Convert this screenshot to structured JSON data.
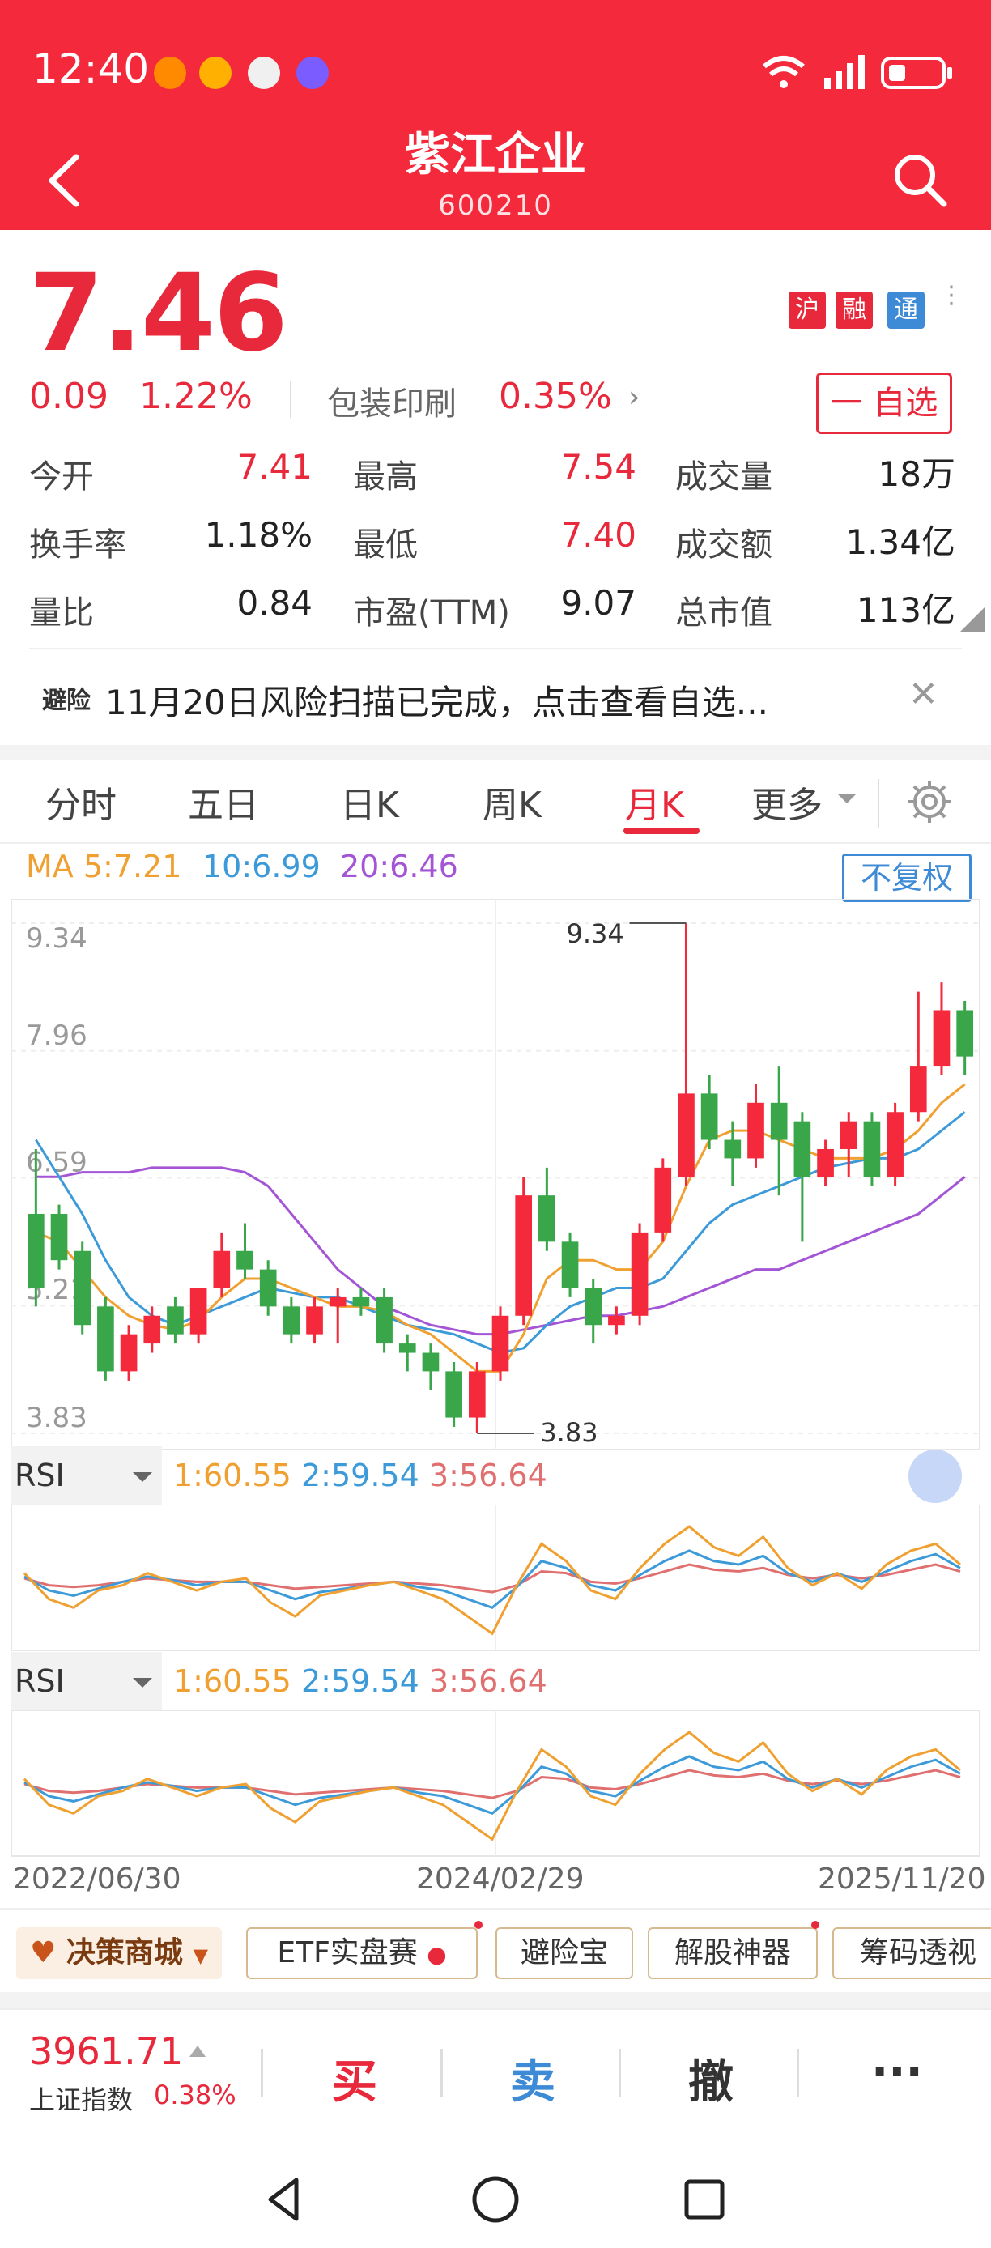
{
  "status": {
    "time": "12:40"
  },
  "header": {
    "title": "紫江企业",
    "code": "600210"
  },
  "quote": {
    "price": "7.46",
    "change": "0.09",
    "change_pct": "1.22%",
    "sector": "包装印刷",
    "sector_pct": "0.35%",
    "badges": [
      "沪",
      "融",
      "通"
    ],
    "watch_label": "一 自选"
  },
  "stats": [
    {
      "label": "今开",
      "value": "7.41",
      "color": "red"
    },
    {
      "label": "最高",
      "value": "7.54",
      "color": "red"
    },
    {
      "label": "成交量",
      "value": "18万",
      "color": "black"
    },
    {
      "label": "换手率",
      "value": "1.18%",
      "color": "black"
    },
    {
      "label": "最低",
      "value": "7.40",
      "color": "red"
    },
    {
      "label": "成交额",
      "value": "1.34亿",
      "color": "black"
    },
    {
      "label": "量比",
      "value": "0.84",
      "color": "black"
    },
    {
      "label": "市盈(TTM)",
      "value": "9.07",
      "color": "black"
    },
    {
      "label": "总市值",
      "value": "113亿",
      "color": "black"
    }
  ],
  "notice": {
    "tag": "避险",
    "text": "11月20日风险扫描已完成，点击查看自选..."
  },
  "tabs": [
    "分时",
    "五日",
    "日K",
    "周K",
    "月K",
    "更多"
  ],
  "active_tab": "月K",
  "ma": {
    "ma5": "MA 5:7.21",
    "ma10": "10:6.99",
    "ma20": "20:6.46",
    "adjust": "不复权"
  },
  "chart_data": {
    "type": "candlestick",
    "y_ticks": [
      "9.34",
      "7.96",
      "6.59",
      "5.21",
      "3.83"
    ],
    "ylim": [
      3.83,
      9.34
    ],
    "max_label": "9.34",
    "min_label": "3.83",
    "x_labels": [
      "2022/06/30",
      "2024/02/29",
      "2025/11/20"
    ],
    "colors": {
      "up": "#f4293b",
      "down": "#38a649",
      "ma5": "#f0a030",
      "ma10": "#3d9ad9",
      "ma20": "#a455d6"
    },
    "candles": [
      [
        6.2,
        5.4,
        6.9,
        5.2
      ],
      [
        6.2,
        5.7,
        6.3,
        5.6
      ],
      [
        5.8,
        5.0,
        5.9,
        4.9
      ],
      [
        5.2,
        4.5,
        5.3,
        4.4
      ],
      [
        4.5,
        4.9,
        5.0,
        4.4
      ],
      [
        4.8,
        5.1,
        5.2,
        4.7
      ],
      [
        5.2,
        4.9,
        5.3,
        4.8
      ],
      [
        4.9,
        5.4,
        5.4,
        4.8
      ],
      [
        5.4,
        5.8,
        6.0,
        5.3
      ],
      [
        5.8,
        5.6,
        6.1,
        5.5
      ],
      [
        5.6,
        5.2,
        5.7,
        5.1
      ],
      [
        5.2,
        4.9,
        5.3,
        4.8
      ],
      [
        4.9,
        5.2,
        5.3,
        4.8
      ],
      [
        5.2,
        5.3,
        5.4,
        4.8
      ],
      [
        5.3,
        5.2,
        5.4,
        5.1
      ],
      [
        5.3,
        4.8,
        5.4,
        4.7
      ],
      [
        4.8,
        4.7,
        4.9,
        4.5
      ],
      [
        4.7,
        4.5,
        4.8,
        4.3
      ],
      [
        4.5,
        4.0,
        4.6,
        3.9
      ],
      [
        4.0,
        4.5,
        4.6,
        3.83
      ],
      [
        4.5,
        5.1,
        5.2,
        4.4
      ],
      [
        5.1,
        6.4,
        6.6,
        5.0
      ],
      [
        6.4,
        5.9,
        6.7,
        5.8
      ],
      [
        5.9,
        5.4,
        6.0,
        5.3
      ],
      [
        5.4,
        5.0,
        5.5,
        4.8
      ],
      [
        5.0,
        5.1,
        5.2,
        4.9
      ],
      [
        5.1,
        6.0,
        6.1,
        5.0
      ],
      [
        6.0,
        6.7,
        6.8,
        5.9
      ],
      [
        6.6,
        7.5,
        9.34,
        6.5
      ],
      [
        7.5,
        7.0,
        7.7,
        6.9
      ],
      [
        7.0,
        6.8,
        7.2,
        6.5
      ],
      [
        6.8,
        7.4,
        7.6,
        6.7
      ],
      [
        7.4,
        7.0,
        7.8,
        6.4
      ],
      [
        7.2,
        6.6,
        7.3,
        5.9
      ],
      [
        6.6,
        6.9,
        7.0,
        6.5
      ],
      [
        6.9,
        7.2,
        7.3,
        6.6
      ],
      [
        7.2,
        6.6,
        7.3,
        6.5
      ],
      [
        6.6,
        7.3,
        7.4,
        6.5
      ],
      [
        7.3,
        7.8,
        8.6,
        7.2
      ],
      [
        7.8,
        8.4,
        8.7,
        7.7
      ],
      [
        8.4,
        7.9,
        8.5,
        7.7
      ]
    ],
    "ma5_y": [
      6.0,
      5.9,
      5.6,
      5.3,
      5.1,
      5.0,
      4.95,
      5.05,
      5.3,
      5.5,
      5.5,
      5.4,
      5.3,
      5.2,
      5.2,
      5.15,
      5.0,
      4.9,
      4.7,
      4.5,
      4.5,
      4.9,
      5.5,
      5.7,
      5.7,
      5.6,
      5.6,
      5.9,
      6.5,
      7.0,
      7.1,
      7.1,
      7.0,
      6.9,
      6.8,
      6.8,
      6.8,
      6.9,
      7.1,
      7.4,
      7.6
    ],
    "ma10_y": [
      7.0,
      6.6,
      6.2,
      5.7,
      5.3,
      5.1,
      5.0,
      5.1,
      5.2,
      5.3,
      5.4,
      5.35,
      5.3,
      5.3,
      5.2,
      5.1,
      5.0,
      4.95,
      4.9,
      4.8,
      4.7,
      4.75,
      5.0,
      5.2,
      5.3,
      5.4,
      5.4,
      5.5,
      5.8,
      6.1,
      6.3,
      6.4,
      6.5,
      6.6,
      6.7,
      6.75,
      6.8,
      6.8,
      6.9,
      7.1,
      7.3
    ],
    "ma20_y": [
      6.6,
      6.6,
      6.65,
      6.65,
      6.65,
      6.7,
      6.7,
      6.7,
      6.7,
      6.65,
      6.5,
      6.2,
      5.9,
      5.6,
      5.4,
      5.2,
      5.1,
      5.0,
      4.95,
      4.9,
      4.9,
      4.95,
      5.0,
      5.05,
      5.1,
      5.1,
      5.15,
      5.2,
      5.3,
      5.4,
      5.5,
      5.6,
      5.6,
      5.7,
      5.8,
      5.9,
      6.0,
      6.1,
      6.2,
      6.4,
      6.6
    ]
  },
  "rsi": [
    {
      "label": "RSI",
      "v1": "1:60.55",
      "v2": "2:59.54",
      "v3": "3:56.64"
    },
    {
      "label": "RSI",
      "v1": "1:60.55",
      "v2": "2:59.54",
      "v3": "3:56.64"
    }
  ],
  "rsi_data": {
    "r1": [
      55,
      40,
      35,
      45,
      48,
      55,
      50,
      45,
      50,
      52,
      38,
      30,
      42,
      45,
      48,
      50,
      45,
      40,
      30,
      20,
      48,
      72,
      62,
      45,
      40,
      58,
      72,
      82,
      70,
      65,
      76,
      58,
      48,
      55,
      46,
      60,
      68,
      72,
      60
    ],
    "r2": [
      53,
      45,
      42,
      46,
      50,
      53,
      51,
      48,
      50,
      50,
      45,
      40,
      44,
      46,
      48,
      50,
      47,
      45,
      40,
      35,
      47,
      62,
      58,
      48,
      45,
      54,
      62,
      68,
      62,
      60,
      65,
      55,
      50,
      55,
      50,
      56,
      62,
      66,
      58
    ],
    "r3": [
      52,
      48,
      47,
      48,
      50,
      52,
      51,
      50,
      50,
      50,
      48,
      46,
      47,
      48,
      49,
      50,
      49,
      48,
      46,
      44,
      48,
      56,
      55,
      50,
      49,
      52,
      56,
      60,
      57,
      56,
      58,
      54,
      52,
      54,
      52,
      54,
      57,
      60,
      56
    ]
  },
  "tools": [
    "决策商城",
    "ETF实盘赛",
    "避险宝",
    "解股神器",
    "筹码透视"
  ],
  "bottom": {
    "index_value": "3961.71",
    "index_name": "上证指数",
    "index_pct": "0.38%",
    "buy": "买",
    "sell": "卖",
    "cancel": "撤",
    "more": "···"
  }
}
